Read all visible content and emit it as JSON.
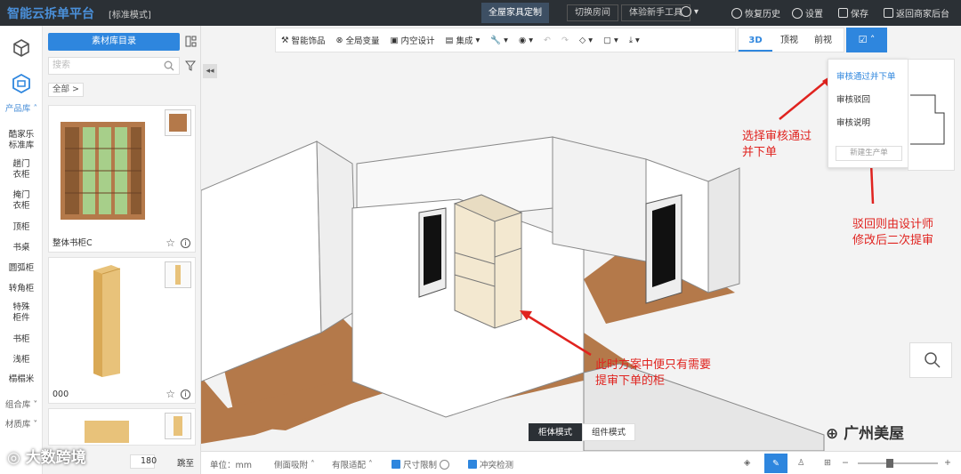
{
  "topbar": {
    "brand": "智能云拆单平台",
    "mode": "[标准模式]",
    "tabs": [
      "全屋家具定制",
      "切换房间",
      "体验新手工具"
    ],
    "actions": {
      "history": "恢复历史",
      "settings": "设置",
      "save": "保存",
      "back": "返回商家后台"
    }
  },
  "iconbar": {
    "categories_header": "产品库",
    "categories": [
      "酷家乐标准库",
      "趟门衣柜",
      "掩门衣柜",
      "顶柜",
      "书桌",
      "圆弧柜",
      "转角柜",
      "特殊柜件",
      "书柜",
      "浅柜",
      "榻榻米"
    ],
    "combo": "组合库",
    "material": "材质库"
  },
  "panel": {
    "catalog_button": "素材库目录",
    "search_placeholder": "搜索",
    "breadcrumb": "全部 >",
    "items": [
      {
        "name": "整体书柜C"
      },
      {
        "name": "000"
      },
      {
        "name": ""
      }
    ],
    "pager": {
      "total": "180",
      "jump": "跳至"
    }
  },
  "toolbar": {
    "items": [
      "智能饰品",
      "全局变量",
      "内空设计",
      "集成",
      "",
      "",
      "",
      "",
      "",
      ""
    ]
  },
  "view_tabs": [
    "3D",
    "顶视",
    "前视"
  ],
  "dropdown": {
    "items": [
      "审核通过并下单",
      "审核驳回",
      "审核说明"
    ],
    "new_button": "新建生产单"
  },
  "annotations": {
    "a1": "选择审核通过\n并下单",
    "a2": "驳回则由设计师\n修改后二次提审",
    "a3": "此时方案中便只有需要\n提审下单的柜"
  },
  "mode_bar": [
    "柜体模式",
    "组件模式"
  ],
  "bottom": {
    "unit": "单位：mm",
    "side": "侧面吸附",
    "limit": "有限适配",
    "size": "尺寸限制",
    "collision": "冲突检测"
  },
  "watermarks": {
    "left": "大数跨境",
    "right": "广州美屋"
  },
  "colors": {
    "accent": "#2e86de",
    "topbar": "#2b3035",
    "annotation": "#e0231f",
    "wood": "#b4794a"
  }
}
